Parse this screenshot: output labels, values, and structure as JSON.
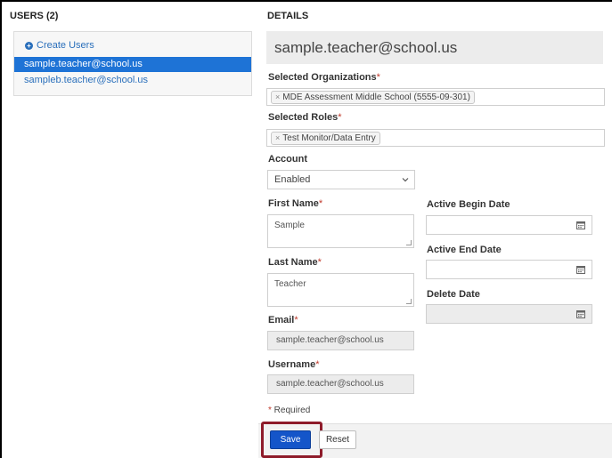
{
  "users_panel": {
    "heading": "USERS (2)",
    "create_label": "Create Users",
    "users": [
      "sample.teacher@school.us",
      "sampleb.teacher@school.us"
    ],
    "selected_index": 0
  },
  "details": {
    "heading": "DETAILS",
    "email_title": "sample.teacher@school.us",
    "organizations_label": "Selected Organizations",
    "organization_tag": "MDE Assessment Middle School (5555-09-301)",
    "roles_label": "Selected Roles",
    "role_tag": "Test Monitor/Data Entry",
    "account_label": "Account",
    "account_value": "Enabled",
    "first_name_label": "First Name",
    "first_name_value": "Sample",
    "last_name_label": "Last Name",
    "last_name_value": "Teacher",
    "email_label": "Email",
    "email_value": "sample.teacher@school.us",
    "username_label": "Username",
    "username_value": "sample.teacher@school.us",
    "active_begin_label": "Active Begin Date",
    "active_begin_value": "",
    "active_end_label": "Active End Date",
    "active_end_value": "",
    "delete_date_label": "Delete Date",
    "delete_date_value": "",
    "required_star": "*",
    "required_note": " Required",
    "tag_remove": "×"
  },
  "actions": {
    "save_label": "Save",
    "reset_label": "Reset"
  },
  "colors": {
    "accent": "#1e73d6",
    "save_button": "#1455c9",
    "highlight": "#8e1b2a",
    "required": "#c0392b"
  }
}
